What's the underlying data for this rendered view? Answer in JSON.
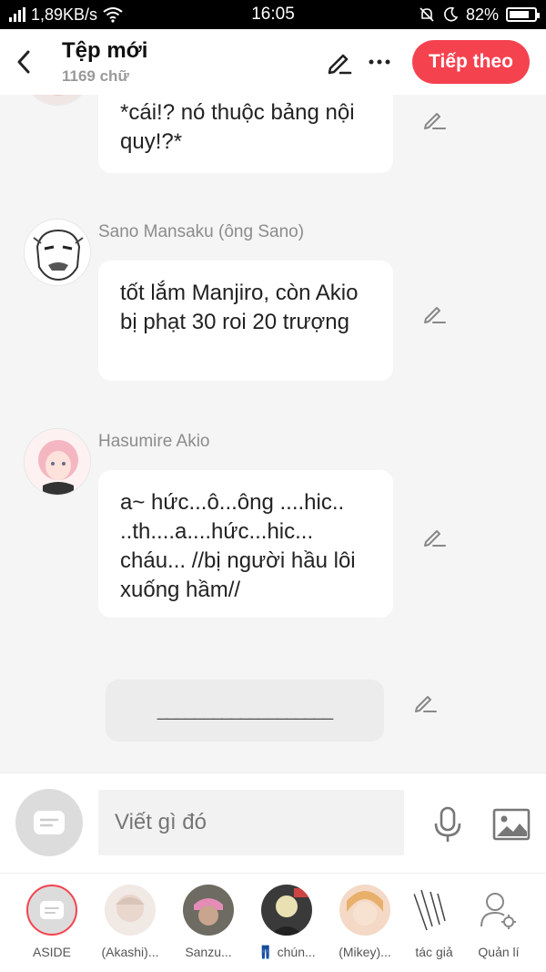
{
  "status_bar": {
    "speed": "1,89KB/s",
    "time": "16:05",
    "battery": "82%",
    "battery_level": 0.82
  },
  "header": {
    "title": "Tệp mới",
    "word_count": "1169 chữ",
    "next_label": "Tiếp theo"
  },
  "messages": [
    {
      "speaker": "",
      "text": "*cái!? nó thuộc bảng nội quy!?*"
    },
    {
      "speaker": "Sano Mansaku (ông Sano)",
      "text": "tốt lắm Manjiro, còn Akio bị phạt 30 roi 20 trượng"
    },
    {
      "speaker": "Hasumire Akio",
      "text": "a~ hức...ô...ông ....hic.. ..th....a....hức...hic... cháu... //bị người hầu lôi xuống hầm//"
    },
    {
      "speaker": "",
      "text": "___________________"
    }
  ],
  "composer": {
    "placeholder": "Viết gì đó"
  },
  "characters": [
    {
      "label": "ASIDE"
    },
    {
      "label": "(Akashi)..."
    },
    {
      "label": "Sanzu..."
    },
    {
      "label": "👖 chún..."
    },
    {
      "label": "(Mikey)..."
    },
    {
      "label": "tác giả"
    },
    {
      "label": "Quản lí"
    }
  ],
  "colors": {
    "accent": "#f5424f",
    "background": "#f5f5f5",
    "name_text": "#8c8c8c"
  }
}
